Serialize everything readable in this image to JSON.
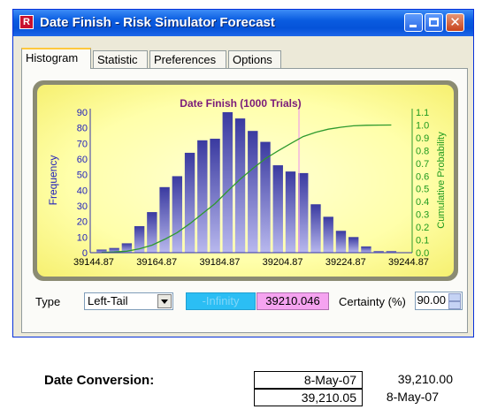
{
  "window": {
    "title": "Date Finish - Risk Simulator Forecast",
    "icon": "risk-simulator-app-icon",
    "close_glyph": "✕"
  },
  "tabs": [
    {
      "label": "Histogram",
      "active": true
    },
    {
      "label": "Statistic",
      "active": false
    },
    {
      "label": "Preferences",
      "active": false
    },
    {
      "label": "Options",
      "active": false
    }
  ],
  "chart_data": {
    "type": "bar",
    "title": "Date Finish (1000 Trials)",
    "ylabel": "Frequency",
    "y2label": "Cumulative Probability",
    "x_tick_labels": [
      "39144.87",
      "39164.87",
      "39184.87",
      "39204.87",
      "39224.87",
      "39244.87"
    ],
    "xlim": [
      39144.87,
      39244.87
    ],
    "ylim": [
      0,
      90
    ],
    "y_ticks": [
      0,
      10,
      20,
      30,
      40,
      50,
      60,
      70,
      80,
      90
    ],
    "y2lim": [
      0,
      1.1
    ],
    "y2_ticks": [
      "0.0",
      "0.1",
      "0.2",
      "0.3",
      "0.4",
      "0.5",
      "0.6",
      "0.7",
      "0.8",
      "0.9",
      "1.0",
      "1.1"
    ],
    "bins": [
      39147.37,
      39151.37,
      39155.37,
      39159.37,
      39163.37,
      39167.37,
      39171.37,
      39175.37,
      39179.37,
      39183.37,
      39187.37,
      39191.37,
      39195.37,
      39199.37,
      39203.37,
      39207.37,
      39211.37,
      39215.37,
      39219.37,
      39223.37,
      39227.37,
      39231.37,
      39235.37,
      39239.37
    ],
    "values": [
      2,
      3,
      6,
      17,
      26,
      42,
      49,
      64,
      72,
      73,
      90,
      86,
      78,
      71,
      56,
      52,
      51,
      31,
      23,
      14,
      10,
      4,
      1,
      1
    ],
    "cumulative_series": {
      "name": "Cumulative Probability",
      "color": "#2e9a2e"
    },
    "bar_color_top": "#3a3aa0",
    "bar_color_bottom": "#b8b8ee",
    "marker_x": 39210.046,
    "marker_color": "#f0a0e8",
    "grid": false
  },
  "controls": {
    "type_label": "Type",
    "type_value": "Left-Tail",
    "lower_value": "-Infinity",
    "upper_value": "39210.046",
    "certainty_label": "Certainty (%)",
    "certainty_value": "90.00"
  },
  "date_conversion": {
    "label": "Date Conversion:",
    "rows": [
      {
        "input": "8-May-07",
        "output": "39,210.00"
      },
      {
        "input": "39,210.05",
        "output": "8-May-07"
      }
    ]
  }
}
